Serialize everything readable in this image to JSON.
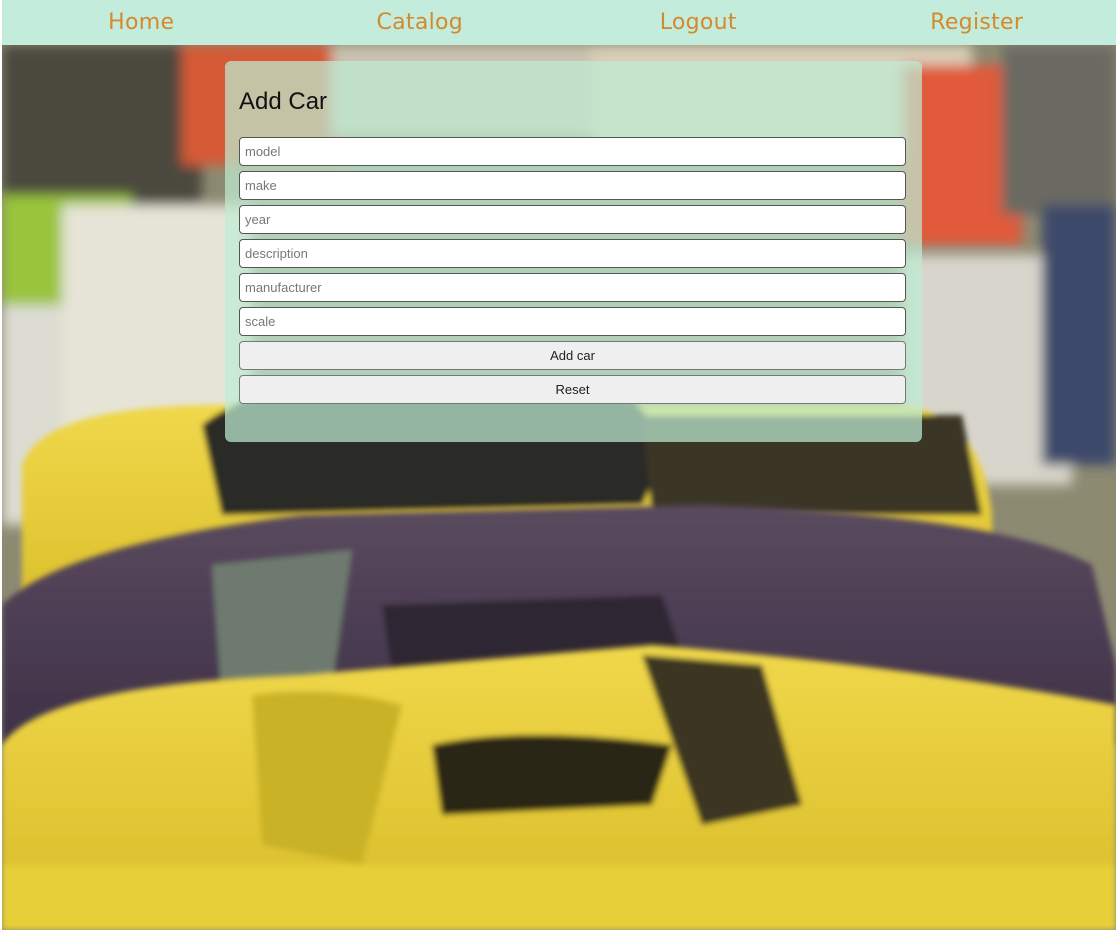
{
  "nav": {
    "home": "Home",
    "catalog": "Catalog",
    "logout": "Logout",
    "register": "Register"
  },
  "form": {
    "title": "Add Car",
    "fields": {
      "model": "model",
      "make": "make",
      "year": "year",
      "description": "description",
      "manufacturer": "manufacturer",
      "scale": "scale"
    },
    "add_button": "Add car",
    "reset_button": "Reset"
  },
  "colors": {
    "nav_background": "#c3ecdc",
    "nav_text": "#d48a2c"
  }
}
